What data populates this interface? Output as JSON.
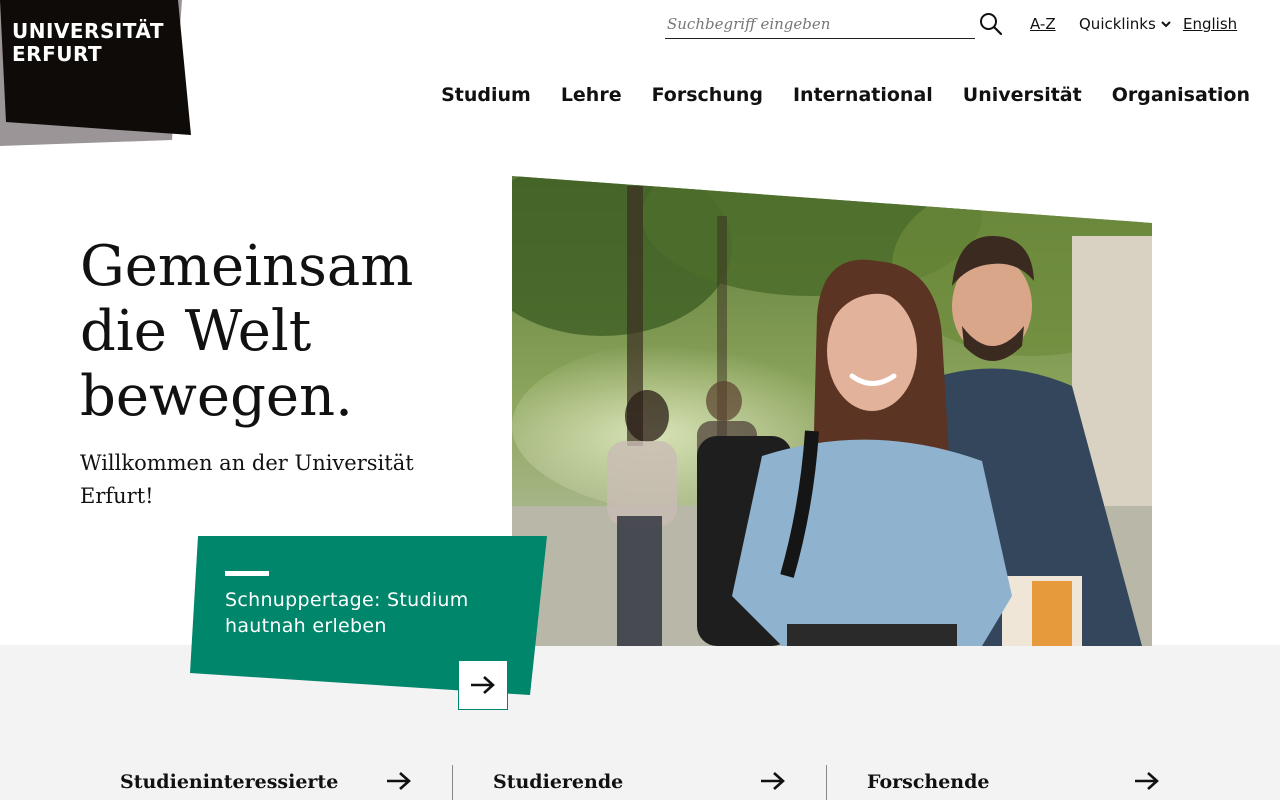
{
  "logo": {
    "line1": "UNIVERSITÄT",
    "line2": "ERFURT"
  },
  "search": {
    "placeholder": "Suchbegriff eingeben",
    "icon": "search-icon"
  },
  "utility": {
    "az": "A-Z",
    "quicklinks": "Quicklinks",
    "english": "English"
  },
  "nav": {
    "items": [
      "Studium",
      "Lehre",
      "Forschung",
      "International",
      "Universität",
      "Organisation"
    ]
  },
  "hero": {
    "title_lines": [
      "Gemeinsam",
      "die Welt",
      "bewegen."
    ],
    "subtitle_lines": [
      "Willkommen an der Universität",
      "Erfurt!"
    ]
  },
  "teaser": {
    "text_lines": [
      "Schnuppertage: Studium",
      "hautnah erleben"
    ],
    "icon": "arrow-right-icon"
  },
  "audience": {
    "items": [
      "Studieninteressierte",
      "Studierende",
      "Forschende"
    ]
  },
  "colors": {
    "brand_black": "#0f0b09",
    "logo_shadow": "#9b9597",
    "teaser_green": "#00866b",
    "gray_band": "#f3f3f3"
  }
}
